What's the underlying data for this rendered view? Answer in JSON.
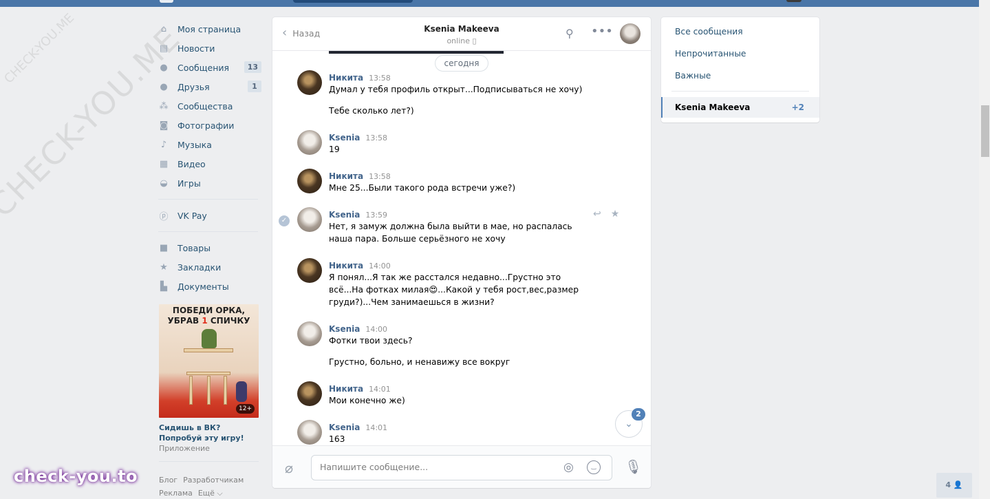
{
  "nav": {
    "items": [
      {
        "label": "Моя страница",
        "icon": "home-icon"
      },
      {
        "label": "Новости",
        "icon": "news-icon"
      },
      {
        "label": "Сообщения",
        "icon": "messages-icon",
        "badge": "13"
      },
      {
        "label": "Друзья",
        "icon": "friends-icon",
        "badge": "1"
      },
      {
        "label": "Сообщества",
        "icon": "communities-icon"
      },
      {
        "label": "Фотографии",
        "icon": "photos-icon"
      },
      {
        "label": "Музыка",
        "icon": "music-icon"
      },
      {
        "label": "Видео",
        "icon": "video-icon"
      },
      {
        "label": "Игры",
        "icon": "games-icon"
      }
    ],
    "vkpay": "VK Pay",
    "items2": [
      {
        "label": "Товары",
        "icon": "goods-icon"
      },
      {
        "label": "Закладки",
        "icon": "bookmarks-icon"
      },
      {
        "label": "Документы",
        "icon": "documents-icon"
      }
    ]
  },
  "ad": {
    "line1": "ПОБЕДИ ОРКА,",
    "line2a": "УБРАВ ",
    "line2b": "1",
    "line2c": " СПИЧКУ",
    "age": "12+",
    "title": "Сидишь в ВК? Попробуй эту игру!",
    "subtitle": "Приложение"
  },
  "footer": {
    "blog": "Блог",
    "dev": "Разработчикам",
    "ads": "Реклама",
    "more": "Ещё ⌵"
  },
  "watermark": {
    "big": "CHECK-YOU.ME",
    "small": "CHECK-YOU.ME",
    "brand": "check-you.to"
  },
  "chat": {
    "back_label": "Назад",
    "peer_name": "Ksenia Makeeva",
    "peer_status": "online",
    "date_divider": "сегодня",
    "messages": [
      {
        "author": "Никита",
        "time": "13:58",
        "text": "Думал у тебя профиль открыт...Подписываться не хочу)"
      },
      {
        "author": "",
        "time": "",
        "text": "Тебе сколько лет?)"
      },
      {
        "author": "Ksenia",
        "time": "13:58",
        "text": "19"
      },
      {
        "author": "Никита",
        "time": "13:58",
        "text": "Мне 25...Были такого рода встречи уже?)"
      },
      {
        "author": "Ksenia",
        "time": "13:59",
        "text": "Нет, я замуж должна была выйти в мае, но распалась наша пара. Больше серьёзного не хочу"
      },
      {
        "author": "Никита",
        "time": "14:00",
        "text": "Я понял...Я так же расстался недавно...Грустно это всё...На фотках милая😍...Какой у тебя рост,вес,размер груди?)...Чем занимаешься в жизни?"
      },
      {
        "author": "Ksenia",
        "time": "14:00",
        "text": "Фотки твои здесь?"
      },
      {
        "author": "",
        "time": "",
        "text": "Грустно, больно, и ненавижу все вокруг"
      },
      {
        "author": "Никита",
        "time": "14:01",
        "text": "Мои конечно же)"
      },
      {
        "author": "Ksenia",
        "time": "14:01",
        "text": "163"
      }
    ],
    "unread_badge": "2",
    "composer_placeholder": "Напишите сообщение..."
  },
  "right": {
    "all": "Все сообщения",
    "unread": "Непрочитанные",
    "important": "Важные",
    "active_name": "Ksenia Makeeva",
    "active_count": "+2"
  },
  "online_widget": "4 👤"
}
